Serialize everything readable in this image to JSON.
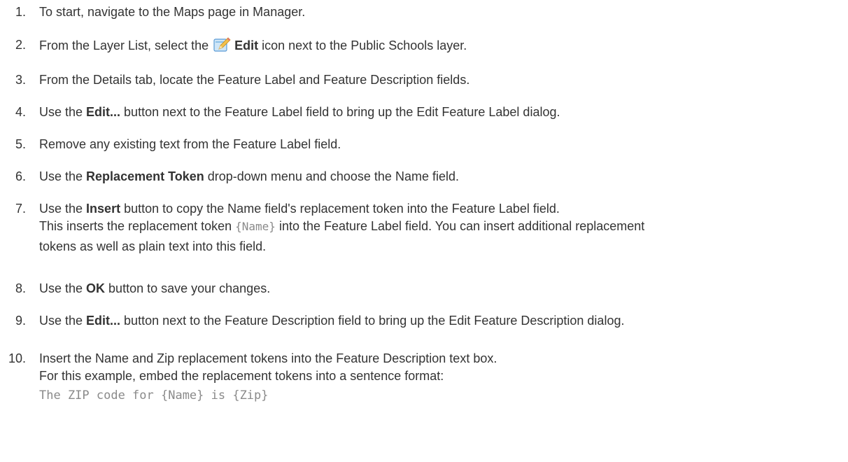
{
  "steps": [
    {
      "num": "1.",
      "text": "To start, navigate to the Maps page in Manager."
    },
    {
      "num": "2.",
      "pre": "From the Layer List, select the ",
      "bold": "Edit",
      "post": " icon next to the Public Schools layer.",
      "icon": "edit-pencil-icon"
    },
    {
      "num": "3.",
      "text": "From the Details tab, locate the Feature Label and Feature Description fields."
    },
    {
      "num": "4.",
      "pre": "Use the ",
      "bold": "Edit...",
      "post": " button next to the Feature Label field to bring up the Edit Feature Label dialog."
    },
    {
      "num": "5.",
      "text": "Remove any existing text from the Feature Label field."
    },
    {
      "num": "6.",
      "pre": "Use the ",
      "bold": "Replacement Token",
      "post": " drop-down menu and choose the Name field."
    },
    {
      "num": "7.",
      "pre": "Use the ",
      "bold": "Insert",
      "post": " button to copy the Name field's replacement token into the Feature Label field.",
      "note_pre": "This inserts the replacement token ",
      "note_code": "{Name}",
      "note_post": " into the Feature Label field. You can insert additional replacement",
      "note_line2": "tokens as well as plain text into this field."
    },
    {
      "num": "8.",
      "pre": "Use the ",
      "bold": "OK",
      "post": " button to save your changes."
    },
    {
      "num": "9.",
      "pre": "Use the ",
      "bold": "Edit...",
      "post": " button next to the Feature Description field to bring up the Edit Feature Description dialog."
    },
    {
      "num": "10.",
      "text": "Insert the Name and Zip replacement tokens into the Feature Description text box.",
      "note": "For this example, embed the replacement tokens into a sentence format:",
      "code": "The ZIP code for {Name} is {Zip}"
    }
  ]
}
